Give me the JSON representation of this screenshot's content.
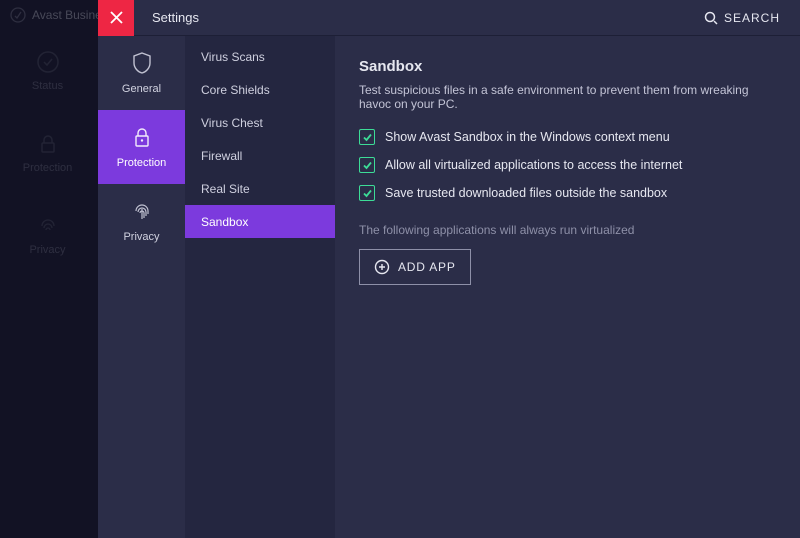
{
  "app": {
    "brand": "Avast Business"
  },
  "shell_nav": {
    "status": "Status",
    "protection": "Protection",
    "privacy": "Privacy"
  },
  "modal": {
    "title": "Settings",
    "search_label": "SEARCH"
  },
  "categories": {
    "general": "General",
    "protection": "Protection",
    "privacy": "Privacy",
    "active": "protection"
  },
  "subnav": {
    "items": [
      "Virus Scans",
      "Core Shields",
      "Virus Chest",
      "Firewall",
      "Real Site",
      "Sandbox"
    ],
    "active_index": 5
  },
  "sandbox": {
    "heading": "Sandbox",
    "description": "Test suspicious files in a safe environment to prevent them from wreaking havoc on your PC.",
    "options": [
      {
        "label": "Show Avast Sandbox in the Windows context menu",
        "checked": true
      },
      {
        "label": "Allow all virtualized applications to access the internet",
        "checked": true
      },
      {
        "label": "Save trusted downloaded files outside the sandbox",
        "checked": true
      }
    ],
    "virtualized_note": "The following applications will always run virtualized",
    "add_app_label": "ADD APP"
  },
  "colors": {
    "accent": "#7c3add",
    "danger": "#ee2644",
    "success": "#3ddc97",
    "bg_dark": "#20213a",
    "bg_modal": "#2b2d48",
    "bg_sub": "#242640"
  }
}
